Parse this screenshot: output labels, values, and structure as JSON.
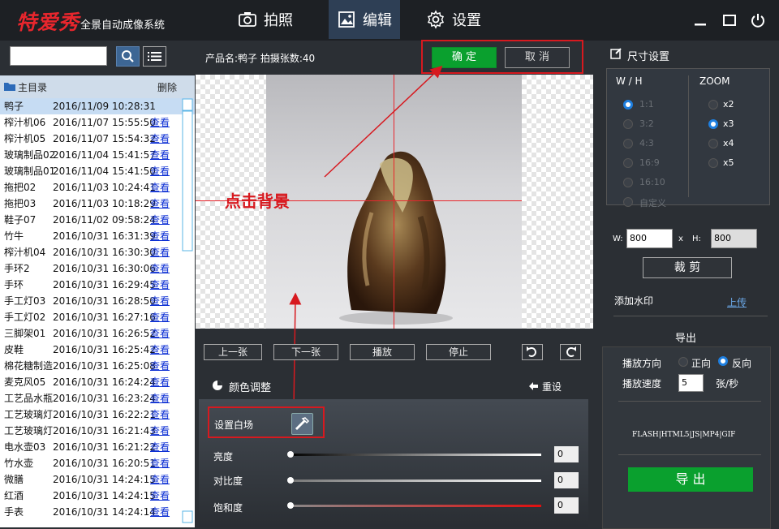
{
  "header": {
    "brand": "特爱秀",
    "brand_sub": "全景自动成像系统",
    "nav": [
      {
        "label": "拍照",
        "icon": "camera-icon"
      },
      {
        "label": "编辑",
        "icon": "image-icon"
      },
      {
        "label": "设置",
        "icon": "gear-icon"
      }
    ],
    "active_nav": "编辑"
  },
  "sidebar": {
    "search_value": "",
    "tree_title": "主目录",
    "delete_label": "删除",
    "view_label": "查看",
    "files": [
      {
        "name": "鸭子",
        "time": "2016/11/09 10:28:31"
      },
      {
        "name": "榨汁机06",
        "time": "2016/11/07 15:55:50"
      },
      {
        "name": "榨汁机05",
        "time": "2016/11/07 15:54:32"
      },
      {
        "name": "玻璃制品02",
        "time": "2016/11/04 15:41:57"
      },
      {
        "name": "玻璃制品01",
        "time": "2016/11/04 15:41:50"
      },
      {
        "name": "拖把02",
        "time": "2016/11/03 10:24:41"
      },
      {
        "name": "拖把03",
        "time": "2016/11/03 10:18:29"
      },
      {
        "name": "鞋子07",
        "time": "2016/11/02 09:58:24"
      },
      {
        "name": "竹牛",
        "time": "2016/10/31 16:31:39"
      },
      {
        "name": "榨汁机04",
        "time": "2016/10/31 16:30:30"
      },
      {
        "name": "手环2",
        "time": "2016/10/31 16:30:06"
      },
      {
        "name": "手环",
        "time": "2016/10/31 16:29:45"
      },
      {
        "name": "手工灯03",
        "time": "2016/10/31 16:28:50"
      },
      {
        "name": "手工灯02",
        "time": "2016/10/31 16:27:16"
      },
      {
        "name": "三脚架01",
        "time": "2016/10/31 16:26:52"
      },
      {
        "name": "皮鞋",
        "time": "2016/10/31 16:25:42"
      },
      {
        "name": "棉花糖制造",
        "time": "2016/10/31 16:25:08"
      },
      {
        "name": "麦克风05",
        "time": "2016/10/31 16:24:24"
      },
      {
        "name": "工艺品水瓶",
        "time": "2016/10/31 16:23:24"
      },
      {
        "name": "工艺玻璃灯",
        "time": "2016/10/31 16:22:21"
      },
      {
        "name": "工艺玻璃灯",
        "time": "2016/10/31 16:21:43"
      },
      {
        "name": "电水壶03",
        "time": "2016/10/31 16:21:22"
      },
      {
        "name": "竹水壶",
        "time": "2016/10/31 16:20:51"
      },
      {
        "name": "微膳",
        "time": "2016/10/31 14:24:15"
      },
      {
        "name": "红酒",
        "time": "2016/10/31 14:24:15"
      },
      {
        "name": "手表",
        "time": "2016/10/31 14:24:14"
      }
    ]
  },
  "editor": {
    "product_info": "产品名:鸭子   拍摄张数:40",
    "confirm_label": "确 定",
    "cancel_label": "取 消",
    "annotation": "点击背景",
    "prev_label": "上一张",
    "next_label": "下一张",
    "play_label": "播放",
    "stop_label": "停止",
    "color_adjust_label": "颜色调整",
    "reset_label": "重设",
    "white_balance_label": "设置白场",
    "sliders": [
      {
        "label": "亮度",
        "value": "0",
        "level": 0
      },
      {
        "label": "对比度",
        "value": "0",
        "level": 0
      },
      {
        "label": "饱和度",
        "value": "0",
        "level": 0
      }
    ]
  },
  "size_settings": {
    "title": "尺寸设置",
    "wh_header": "W / H",
    "zoom_header": "ZOOM",
    "ratios": [
      "1:1",
      "3:2",
      "4:3",
      "16:9",
      "16:10",
      "自定义"
    ],
    "selected_ratio": "1:1",
    "zooms": [
      "x2",
      "x3",
      "x4",
      "x5"
    ],
    "selected_zoom": "x3",
    "w_label": "W:",
    "w_value": "800",
    "x_label": "x",
    "h_label": "H:",
    "h_value": "800",
    "crop_label": "裁 剪",
    "watermark_label": "添加水印",
    "upload_label": "上传"
  },
  "export": {
    "title": "导出",
    "direction_label": "播放方向",
    "forward_label": "正向",
    "reverse_label": "反向",
    "selected_direction": "反向",
    "speed_label": "播放速度",
    "speed_value": "5",
    "speed_unit": "张/秒",
    "formats": "FLASH|HTML5|JS|MP4|GIF",
    "export_label": "导 出"
  },
  "colors": {
    "accent_green": "#0aa02e",
    "highlight_red": "#d7191f",
    "link_blue": "#0c2fd4"
  }
}
